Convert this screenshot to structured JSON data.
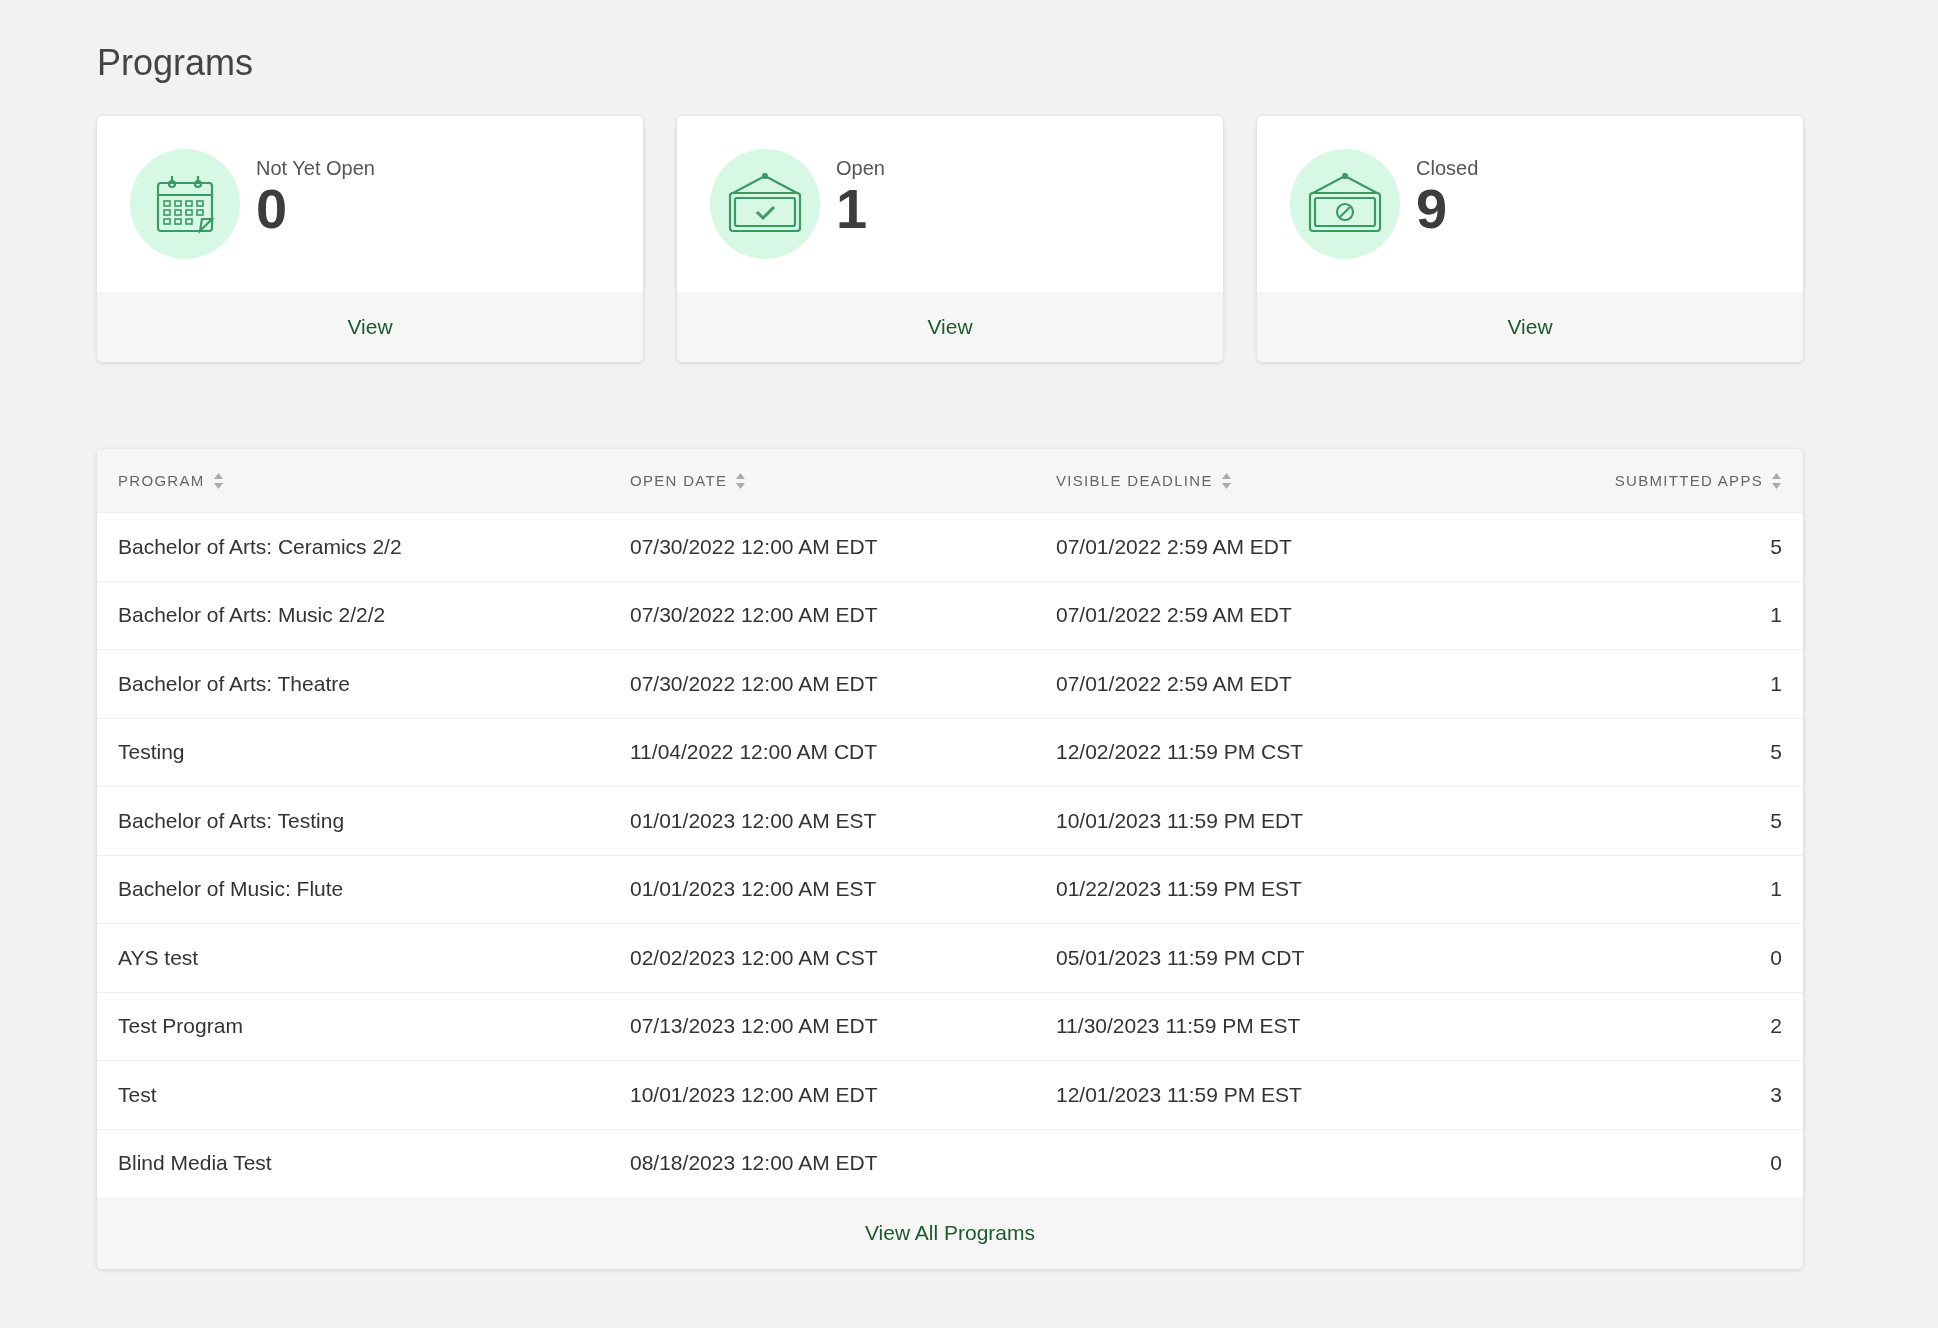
{
  "page_title": "Programs",
  "cards": [
    {
      "kind": "calendar",
      "label": "Not Yet Open",
      "count": "0",
      "link": "View"
    },
    {
      "kind": "open",
      "label": "Open",
      "count": "1",
      "link": "View"
    },
    {
      "kind": "closed",
      "label": "Closed",
      "count": "9",
      "link": "View"
    }
  ],
  "table": {
    "columns": [
      "PROGRAM",
      "OPEN DATE",
      "VISIBLE DEADLINE",
      "SUBMITTED APPS"
    ],
    "rows": [
      [
        "Bachelor of Arts: Ceramics 2/2",
        "07/30/2022 12:00 AM EDT",
        "07/01/2022 2:59 AM EDT",
        "5"
      ],
      [
        "Bachelor of Arts: Music 2/2/2",
        "07/30/2022 12:00 AM EDT",
        "07/01/2022 2:59 AM EDT",
        "1"
      ],
      [
        "Bachelor of Arts: Theatre",
        "07/30/2022 12:00 AM EDT",
        "07/01/2022 2:59 AM EDT",
        "1"
      ],
      [
        "Testing",
        "11/04/2022 12:00 AM CDT",
        "12/02/2022 11:59 PM CST",
        "5"
      ],
      [
        "Bachelor of Arts: Testing",
        "01/01/2023 12:00 AM EST",
        "10/01/2023 11:59 PM EDT",
        "5"
      ],
      [
        "Bachelor of Music: Flute",
        "01/01/2023 12:00 AM EST",
        "01/22/2023 11:59 PM EST",
        "1"
      ],
      [
        "AYS test",
        "02/02/2023 12:00 AM CST",
        "05/01/2023 11:59 PM CDT",
        "0"
      ],
      [
        "Test Program",
        "07/13/2023 12:00 AM EDT",
        "11/30/2023 11:59 PM EST",
        "2"
      ],
      [
        "Test",
        "10/01/2023 12:00 AM EDT",
        "12/01/2023 11:59 PM EST",
        "3"
      ],
      [
        "Blind Media Test",
        "08/18/2023 12:00 AM EDT",
        "",
        "0"
      ]
    ],
    "footer_link": "View All Programs"
  }
}
